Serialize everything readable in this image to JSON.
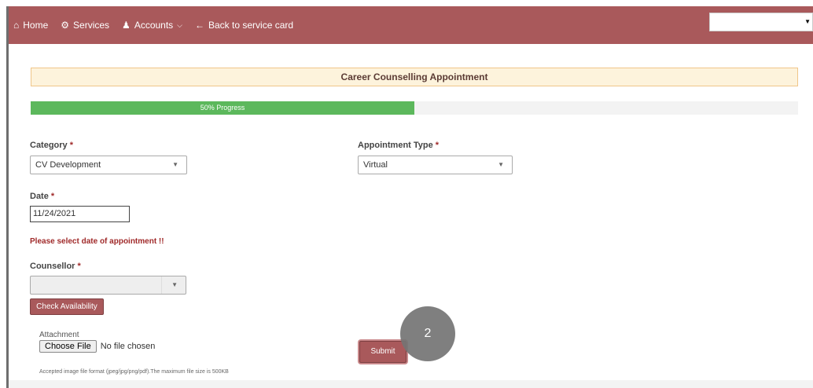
{
  "nav": {
    "home_label": "Home",
    "services_label": "Services",
    "accounts_label": "Accounts",
    "back_label": "Back to service card",
    "home_icon": "home-icon",
    "services_icon": "cogs-icon",
    "accounts_icon": "user-icon",
    "back_icon": "arrow-left-icon"
  },
  "form": {
    "title": "Career Counselling Appointment",
    "progress_text": "50% Progress",
    "progress_value": 0.5,
    "category_label": "Category",
    "category_value": "CV Development",
    "appointment_type_label": "Appointment Type",
    "appointment_type_value": "Virtual",
    "date_label": "Date",
    "date_value": "11/24/2021",
    "error_message": "Please select date of appointment !!",
    "counsellor_label": "Counsellor",
    "counsellor_value": "",
    "check_availability_label": "Check Availability",
    "attachment_label": "Attachment",
    "choose_file_label": "Choose File",
    "no_file_text": "No file chosen",
    "submit_label": "Submit",
    "accepted_formats_text": "Accepted image file format (jpeg/jpg/png/pdf).The maximum file size is 500KB",
    "required_marker": "*"
  },
  "overlay": {
    "step_number": "2"
  },
  "colors": {
    "navbar": "#a9595b",
    "progress": "#5cb85c",
    "title_bg": "#fdf3dc",
    "error": "#a02a2a"
  }
}
